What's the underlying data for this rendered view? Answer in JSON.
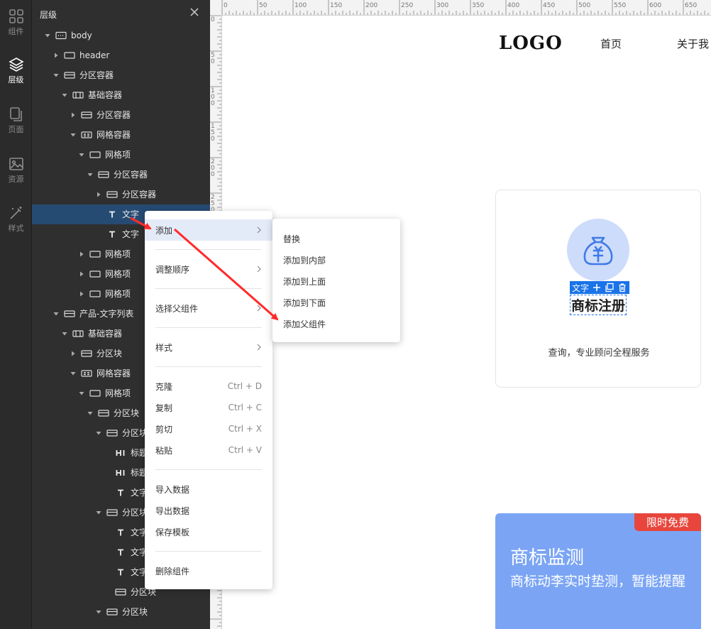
{
  "rail": {
    "items": [
      {
        "label": "组件",
        "icon": "grid-icon"
      },
      {
        "label": "层级",
        "icon": "layers-icon",
        "active": true
      },
      {
        "label": "页面",
        "icon": "pages-icon"
      },
      {
        "label": "资源",
        "icon": "image-icon"
      },
      {
        "label": "样式",
        "icon": "magic-wand-icon"
      }
    ]
  },
  "panel": {
    "title": "层级",
    "tree": [
      {
        "label": "body",
        "indent": 0,
        "caret": "open",
        "icon": "body"
      },
      {
        "label": "header",
        "indent": 1,
        "caret": "closed",
        "icon": "box"
      },
      {
        "label": "分区容器",
        "indent": 1,
        "caret": "open",
        "icon": "section"
      },
      {
        "label": "基础容器",
        "indent": 2,
        "caret": "open",
        "icon": "columns"
      },
      {
        "label": "分区容器",
        "indent": 3,
        "caret": "closed",
        "icon": "section"
      },
      {
        "label": "网格容器",
        "indent": 3,
        "caret": "open",
        "icon": "grid"
      },
      {
        "label": "网格项",
        "indent": 4,
        "caret": "open",
        "icon": "box"
      },
      {
        "label": "分区容器",
        "indent": 5,
        "caret": "open",
        "icon": "section"
      },
      {
        "label": "分区容器",
        "indent": 6,
        "caret": "closed",
        "icon": "section"
      },
      {
        "label": "文字",
        "indent": 6,
        "caret": "none",
        "icon": "text",
        "selected": true
      },
      {
        "label": "文字",
        "indent": 6,
        "caret": "none",
        "icon": "text"
      },
      {
        "label": "网格项",
        "indent": 4,
        "caret": "closed",
        "icon": "box"
      },
      {
        "label": "网格项",
        "indent": 4,
        "caret": "closed",
        "icon": "box"
      },
      {
        "label": "网格项",
        "indent": 4,
        "caret": "closed",
        "icon": "box"
      },
      {
        "label": "产品-文字列表",
        "indent": 1,
        "caret": "open",
        "icon": "section"
      },
      {
        "label": "基础容器",
        "indent": 2,
        "caret": "open",
        "icon": "columns"
      },
      {
        "label": "分区块",
        "indent": 3,
        "caret": "closed",
        "icon": "section"
      },
      {
        "label": "网格容器",
        "indent": 3,
        "caret": "open",
        "icon": "grid"
      },
      {
        "label": "网格项",
        "indent": 4,
        "caret": "open",
        "icon": "box"
      },
      {
        "label": "分区块",
        "indent": 5,
        "caret": "open",
        "icon": "section"
      },
      {
        "label": "分区块",
        "indent": 6,
        "caret": "open",
        "icon": "section"
      },
      {
        "label": "标题",
        "indent": 7,
        "caret": "none",
        "icon": "heading"
      },
      {
        "label": "标题",
        "indent": 7,
        "caret": "none",
        "icon": "heading"
      },
      {
        "label": "文字",
        "indent": 7,
        "caret": "none",
        "icon": "text"
      },
      {
        "label": "分区块",
        "indent": 6,
        "caret": "open",
        "icon": "section"
      },
      {
        "label": "文字",
        "indent": 7,
        "caret": "none",
        "icon": "text"
      },
      {
        "label": "文字",
        "indent": 7,
        "caret": "none",
        "icon": "text"
      },
      {
        "label": "文字",
        "indent": 7,
        "caret": "none",
        "icon": "text"
      },
      {
        "label": "分区块",
        "indent": 7,
        "caret": "none",
        "icon": "section"
      },
      {
        "label": "分区块",
        "indent": 6,
        "caret": "open",
        "icon": "section"
      }
    ]
  },
  "ruler": {
    "top_labels": [
      "0",
      "50",
      "100",
      "150",
      "200",
      "250",
      "300",
      "350",
      "400",
      "450",
      "500",
      "550",
      "600",
      "650"
    ],
    "left_labels": [
      "0",
      "50",
      "100",
      "150",
      "200",
      "250"
    ]
  },
  "canvas": {
    "logo": "LOGO",
    "nav_home": "首页",
    "nav_about": "关于我",
    "card": {
      "toolbar_label": "文字",
      "title": "商标注册",
      "desc": "查询，专业顾问全程服务"
    },
    "card2": {
      "badge": "限时免费",
      "title": "商标监测",
      "desc": "商标动李实时垫测，暂能提醒"
    }
  },
  "context_menu": {
    "items": [
      {
        "label": "添加",
        "submenu": true,
        "hover": true
      },
      {
        "label": "调整顺序",
        "submenu": true
      },
      {
        "label": "选择父组件",
        "submenu": true
      },
      {
        "label": "样式",
        "submenu": true
      },
      {
        "label": "克隆",
        "shortcut": "Ctrl + D"
      },
      {
        "label": "复制",
        "shortcut": "Ctrl + C"
      },
      {
        "label": "剪切",
        "shortcut": "Ctrl + X"
      },
      {
        "label": "粘贴",
        "shortcut": "Ctrl + V"
      },
      {
        "label": "导入数据"
      },
      {
        "label": "导出数据"
      },
      {
        "label": "保存模板"
      },
      {
        "label": "删除组件"
      }
    ]
  },
  "submenu": {
    "items": [
      "替换",
      "添加到内部",
      "添加到上面",
      "添加到下面",
      "添加父组件"
    ]
  },
  "colors": {
    "accent": "#1a73e8",
    "selected_row": "#264b73",
    "annotation_arrow": "#ff2a2a",
    "badge": "#e8453c",
    "card2_bg": "#7ba5f4"
  }
}
